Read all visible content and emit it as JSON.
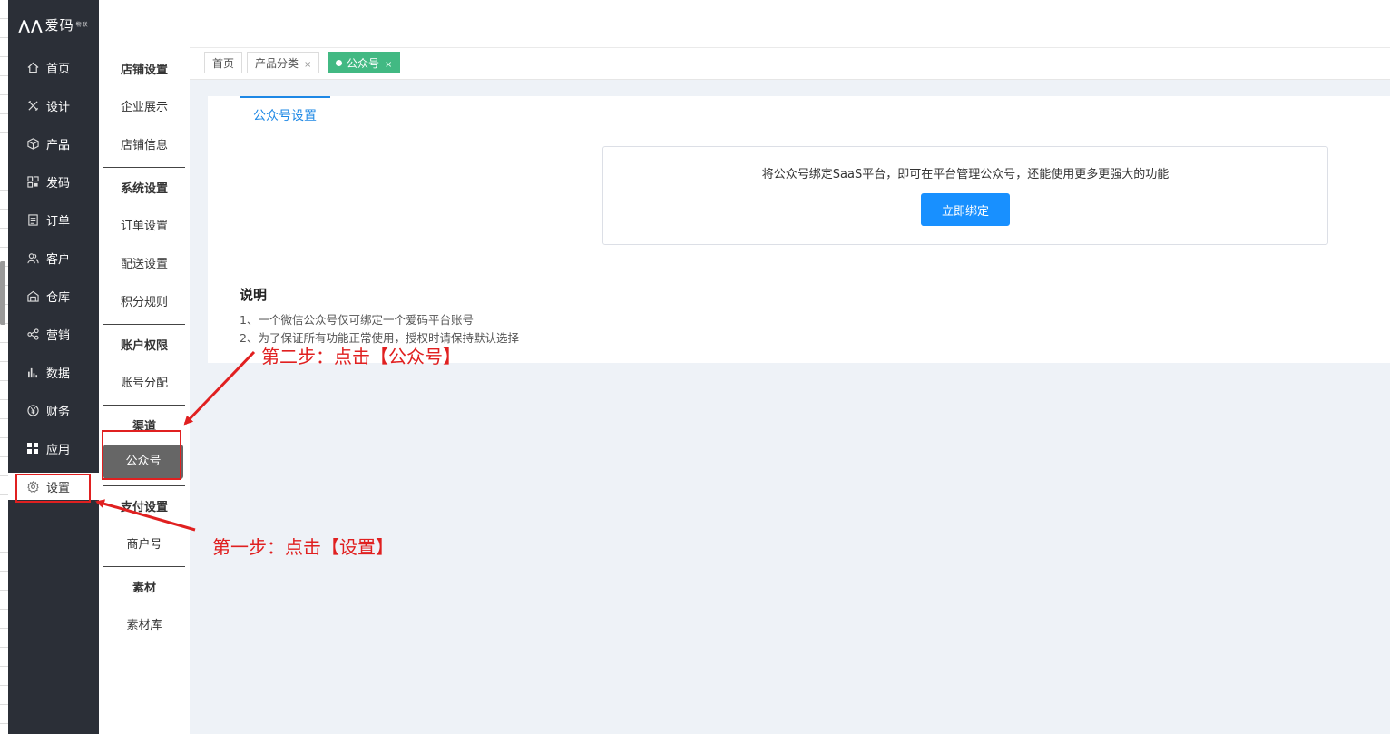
{
  "logo": {
    "text": "爱码",
    "sub": "物联"
  },
  "nav": [
    {
      "label": "首页",
      "icon": "home-icon"
    },
    {
      "label": "设计",
      "icon": "design-icon"
    },
    {
      "label": "产品",
      "icon": "box-icon"
    },
    {
      "label": "发码",
      "icon": "qrcode-icon"
    },
    {
      "label": "订单",
      "icon": "order-icon"
    },
    {
      "label": "客户",
      "icon": "user-group-icon"
    },
    {
      "label": "仓库",
      "icon": "warehouse-icon"
    },
    {
      "label": "营销",
      "icon": "share-icon"
    },
    {
      "label": "数据",
      "icon": "bar-chart-icon"
    },
    {
      "label": "财务",
      "icon": "yen-icon"
    },
    {
      "label": "应用",
      "icon": "apps-icon"
    },
    {
      "label": "设置",
      "icon": "gear-icon"
    }
  ],
  "subnav": {
    "store_head": "店铺设置",
    "store_items": [
      "企业展示",
      "店铺信息"
    ],
    "system_head": "系统设置",
    "system_items": [
      "订单设置",
      "配送设置",
      "积分规则"
    ],
    "account_head": "账户权限",
    "account_items": [
      "账号分配"
    ],
    "channel_head": "渠道",
    "channel_items": [
      "公众号"
    ],
    "pay_head": "支付设置",
    "pay_items": [
      "商户号"
    ],
    "material_head": "素材",
    "material_items": [
      "素材库"
    ]
  },
  "tabs": [
    {
      "label": "首页",
      "closable": false
    },
    {
      "label": "产品分类",
      "closable": true
    },
    {
      "label": "公众号",
      "closable": true,
      "active": true
    }
  ],
  "tab_close": "×",
  "panel": {
    "tab": "公众号设置",
    "bind_text": "将公众号绑定SaaS平台，即可在平台管理公众号，还能使用更多更强大的功能",
    "bind_button": "立即绑定",
    "note_title": "说明",
    "notes": [
      "1、一个微信公众号仅可绑定一个爱码平台账号",
      "2、为了保证所有功能正常使用，授权时请保持默认选择"
    ]
  },
  "annotations": {
    "step2": "第二步：点击【公众号】",
    "step1": "第一步：点击【设置】"
  },
  "colors": {
    "sidebar": "#2b2f37",
    "active_tab": "#42b983",
    "primary_button": "#1890ff",
    "annotation": "#e02020"
  }
}
